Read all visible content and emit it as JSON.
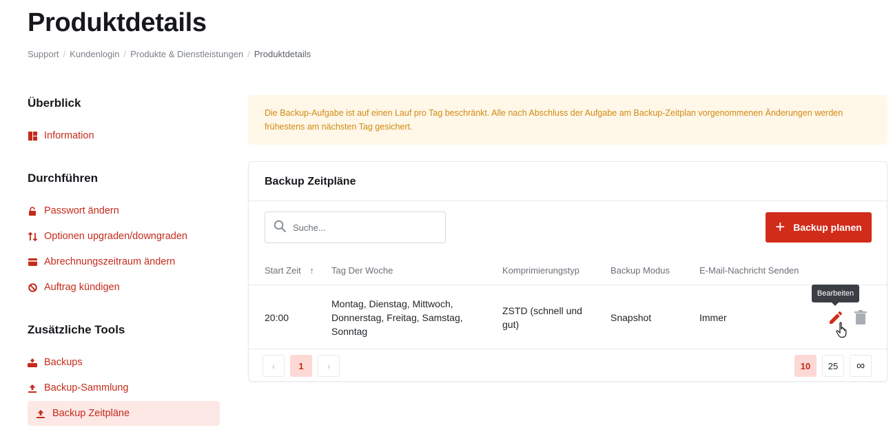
{
  "page": {
    "title": "Produktdetails",
    "breadcrumb": [
      "Support",
      "Kundenlogin",
      "Produkte & Dienstleistungen",
      "Produktdetails"
    ]
  },
  "sidebar": {
    "sections": [
      {
        "heading": "Überblick",
        "items": [
          {
            "label": "Information",
            "icon": "dashboard-icon"
          }
        ]
      },
      {
        "heading": "Durchführen",
        "items": [
          {
            "label": "Passwort ändern",
            "icon": "unlock-icon"
          },
          {
            "label": "Optionen upgraden/downgraden",
            "icon": "swap-icon"
          },
          {
            "label": "Abrechnungszeitraum ändern",
            "icon": "card-icon"
          },
          {
            "label": "Auftrag kündigen",
            "icon": "ban-icon"
          }
        ]
      },
      {
        "heading": "Zusätzliche Tools",
        "items": [
          {
            "label": "Backups",
            "icon": "backup-icon"
          },
          {
            "label": "Backup-Sammlung",
            "icon": "upload-icon"
          },
          {
            "label": "Backup Zeitpläne",
            "icon": "upload-icon",
            "active": true
          }
        ]
      }
    ]
  },
  "alert": {
    "text": "Die Backup-Aufgabe ist auf einen Lauf pro Tag beschränkt. Alle nach Abschluss der Aufgabe am Backup-Zeitplan vorgenommenen Änderungen werden frühestens am nächsten Tag gesichert."
  },
  "card": {
    "title": "Backup Zeitpläne",
    "search_placeholder": "Suche...",
    "add_button": "Backup planen"
  },
  "table": {
    "columns": [
      "Start Zeit",
      "Tag Der Woche",
      "Komprimierungstyp",
      "Backup Modus",
      "E-Mail-Nachricht Senden"
    ],
    "sort_indicator": "↑",
    "rows": [
      {
        "start": "20:00",
        "days_line1": "Montag, Dienstag, Mittwoch,",
        "days_line2": "Donnerstag, Freitag, Samstag,",
        "days_line3": "Sonntag",
        "compression_line1": "ZSTD (schnell und",
        "compression_line2": "gut)",
        "mode": "Snapshot",
        "email": "Immer"
      }
    ],
    "tooltip": "Bearbeiten"
  },
  "pagination": {
    "prev": "‹",
    "next": "›",
    "current": "1",
    "page_sizes": [
      "10",
      "25",
      "∞"
    ]
  },
  "colors": {
    "accent": "#d12c1a",
    "sidebar_link": "#c42b1c",
    "alert_bg": "#fff7e8",
    "alert_text": "#d08a12",
    "active_bg": "#fde8e6"
  }
}
